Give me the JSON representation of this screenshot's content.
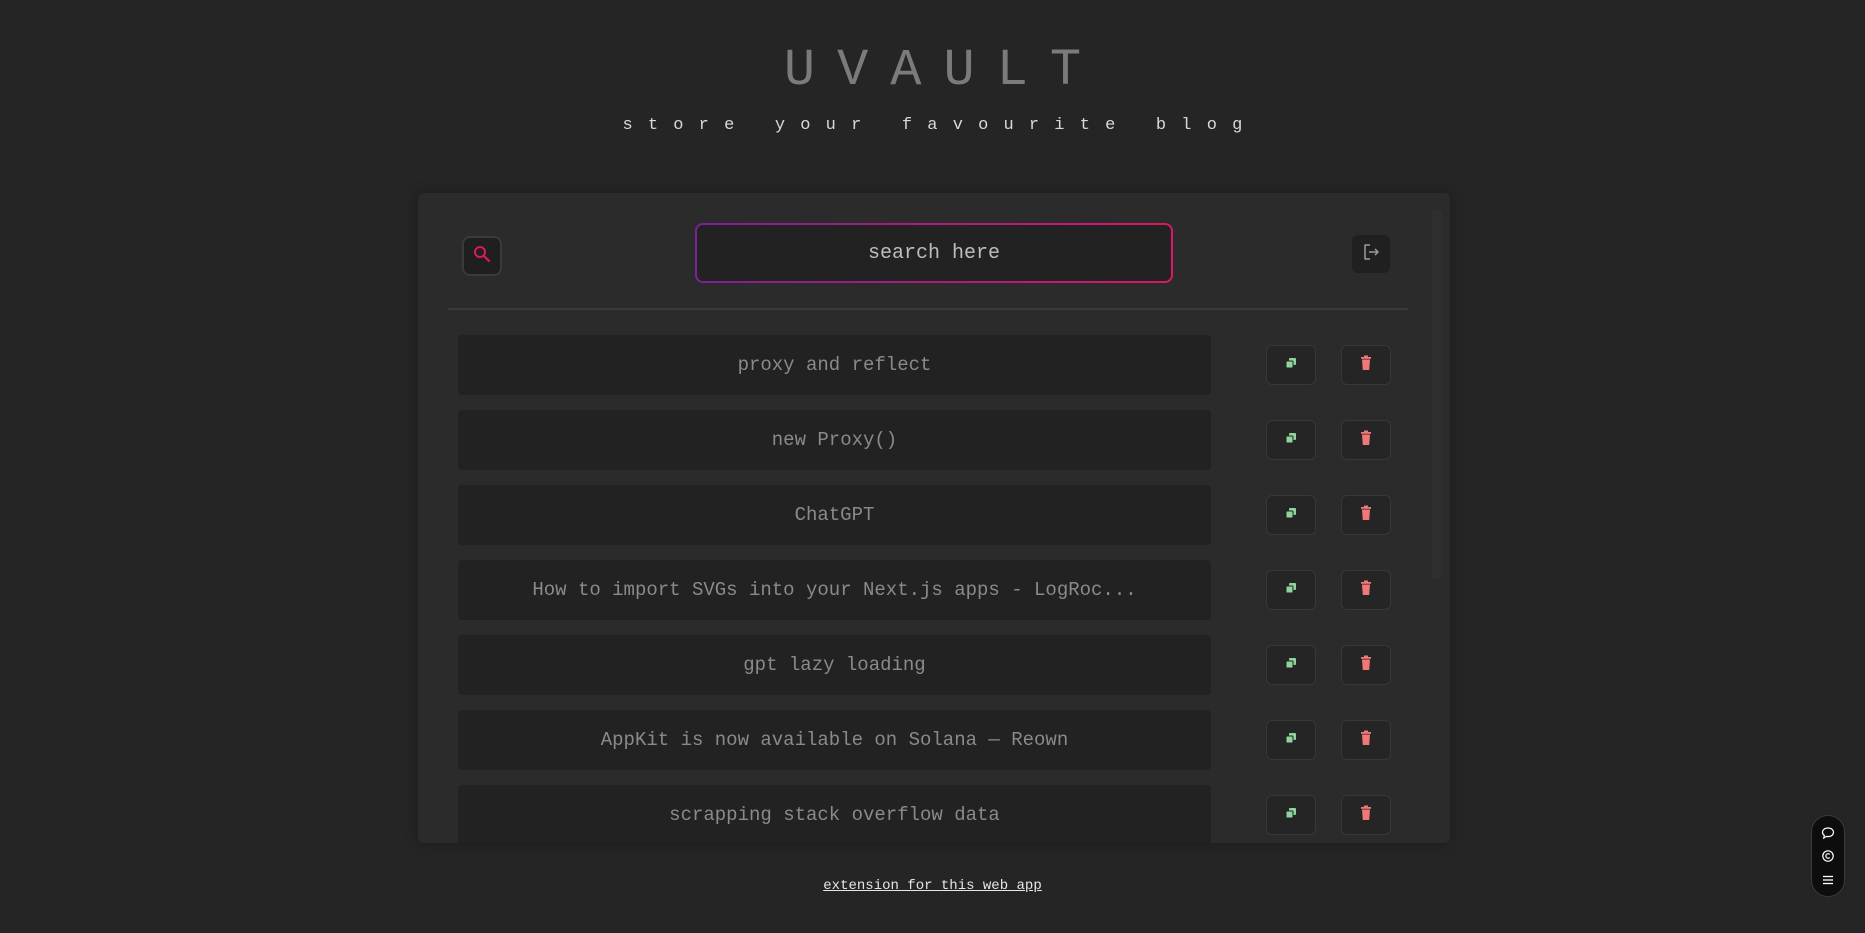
{
  "header": {
    "title": "UVAULT",
    "subtitle": "store your favourite blog"
  },
  "toolbar": {
    "search_placeholder": "search here",
    "search_icon": "search-icon",
    "logout_icon": "logout-icon"
  },
  "blogs": [
    {
      "title": "proxy and reflect"
    },
    {
      "title": "new Proxy()"
    },
    {
      "title": "ChatGPT"
    },
    {
      "title": "How to import SVGs into your Next.js apps - LogRoc..."
    },
    {
      "title": "gpt lazy loading"
    },
    {
      "title": "AppKit is now available on Solana — Reown"
    },
    {
      "title": "scrapping stack overflow data"
    }
  ],
  "row_actions": {
    "copy_icon": "copy-icon",
    "delete_icon": "trash-icon"
  },
  "footer": {
    "link_text": "extension for this web app"
  },
  "floating_menu": {
    "icons": [
      "chat-icon",
      "copyright-icon",
      "menu-icon"
    ]
  },
  "colors": {
    "background": "#252525",
    "accent_pink": "#d91866",
    "accent_purple": "#7d2196",
    "copy_green": "#8fd49a",
    "delete_red": "#f07878"
  }
}
